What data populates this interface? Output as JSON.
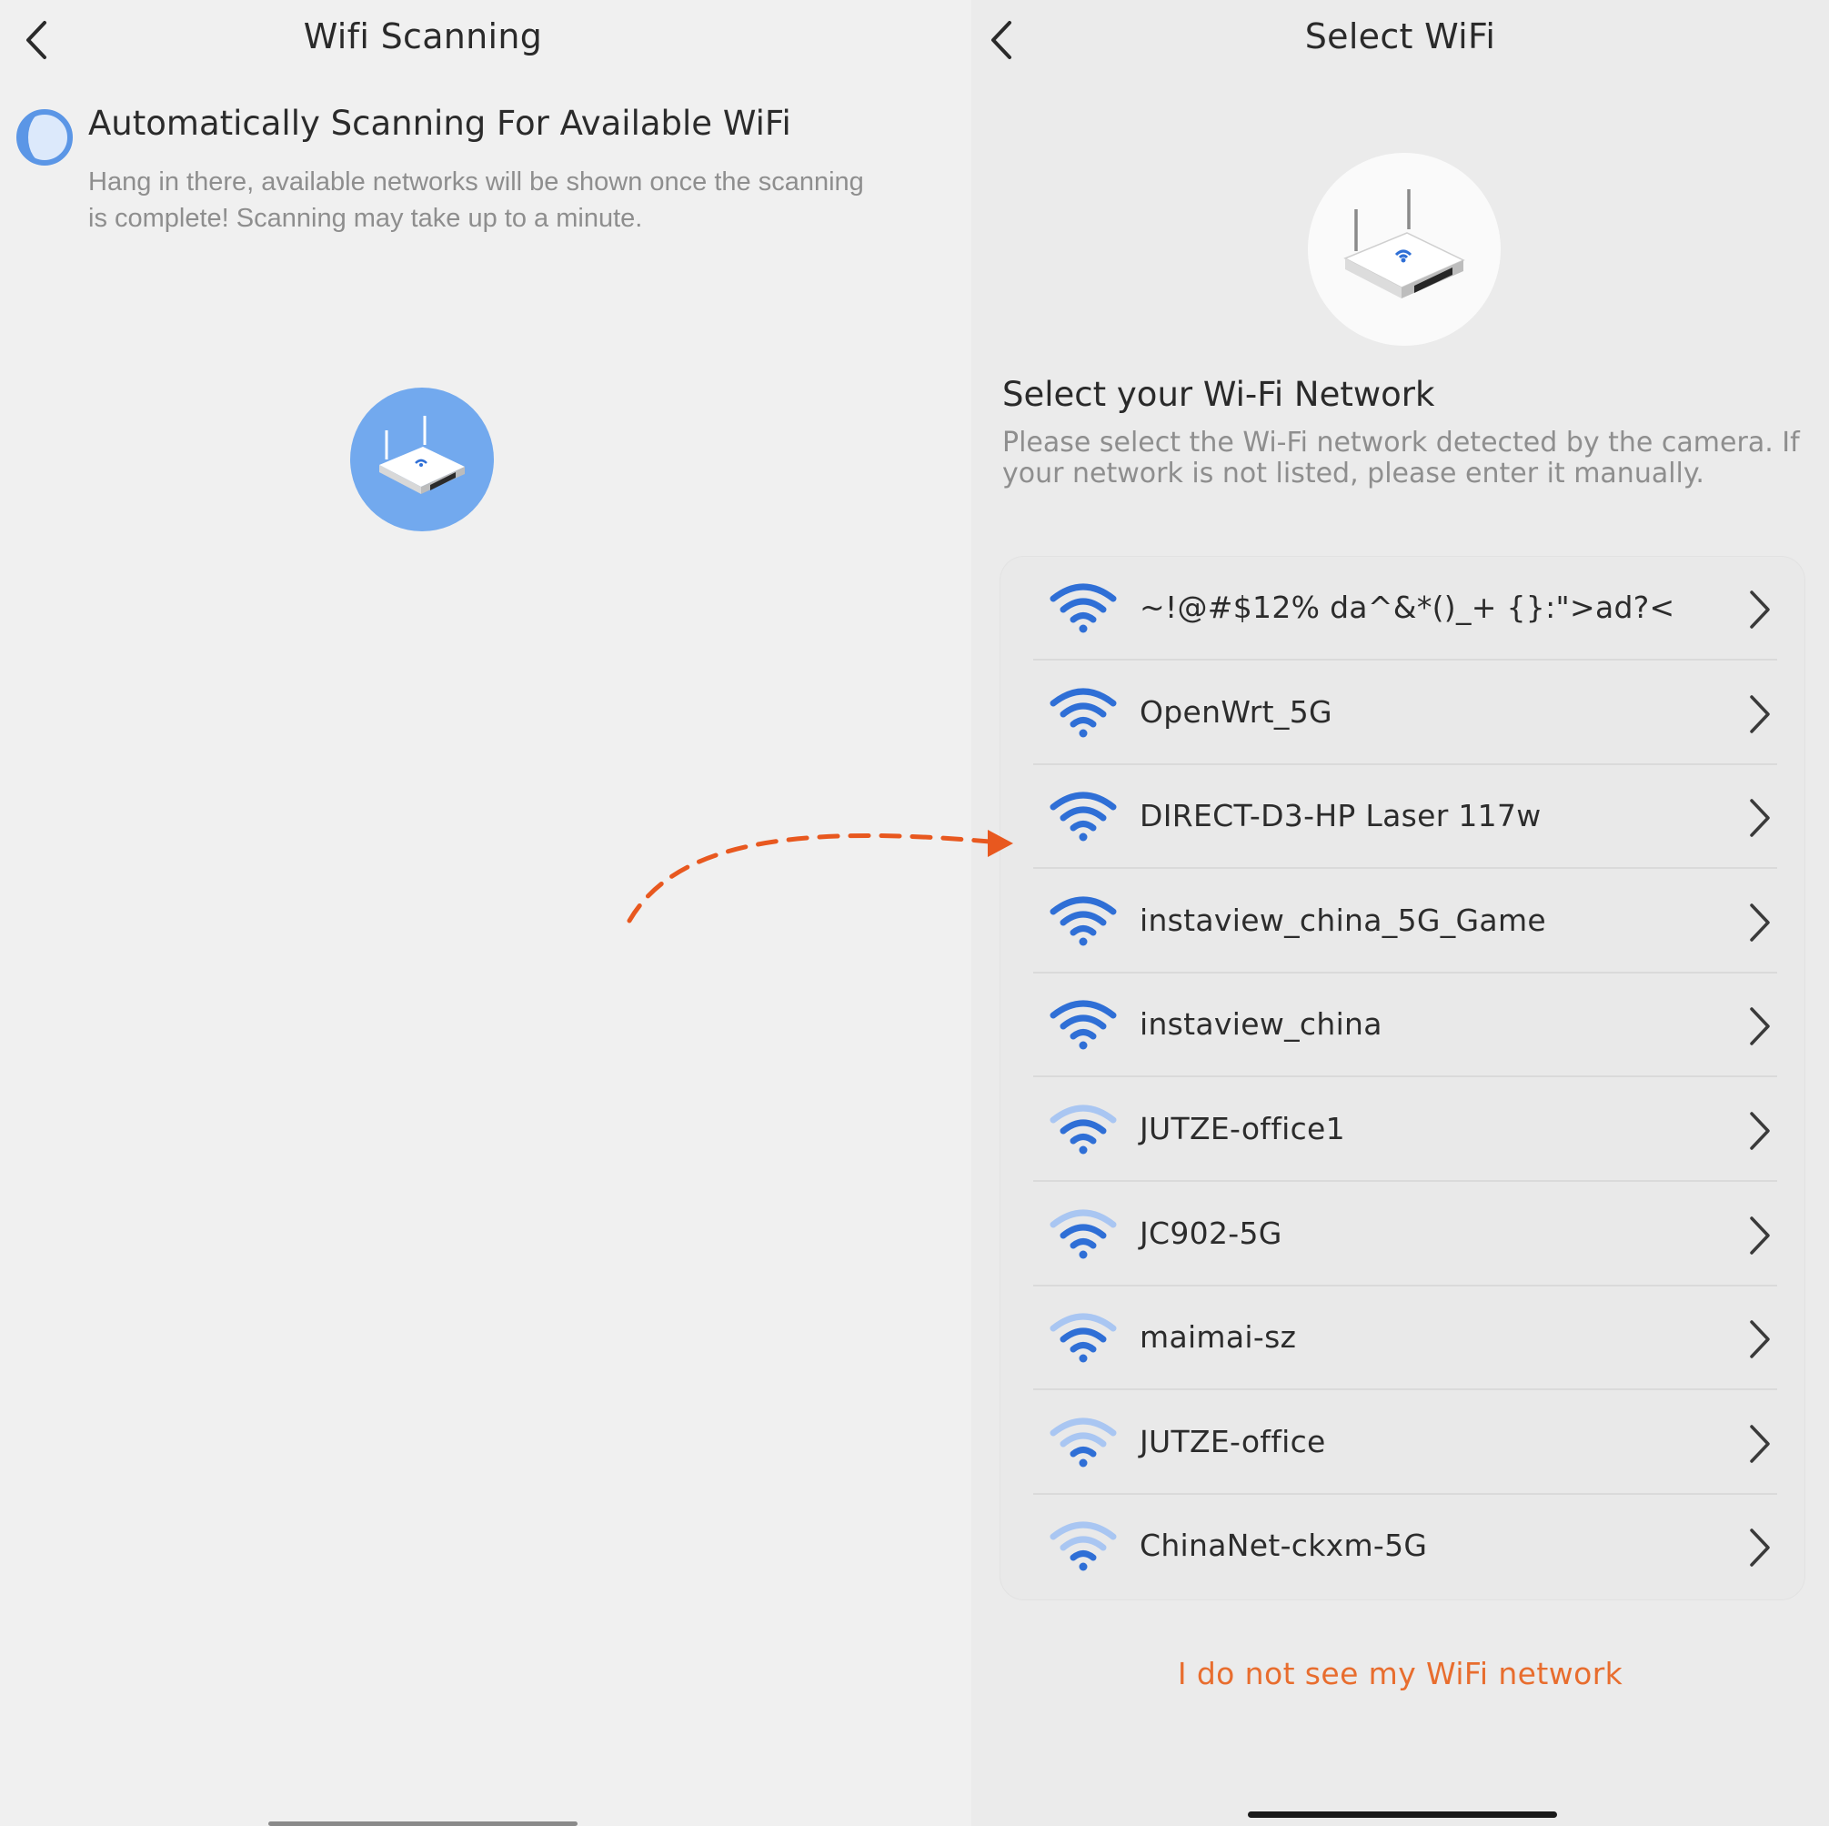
{
  "left_screen": {
    "title": "Wifi Scanning",
    "scan_heading": "Automatically Scanning For Available WiFi",
    "scan_message": "Hang in there, available networks will be shown once the scanning is complete! Scanning may take up to a minute.",
    "icons": {
      "back": "chevron-left-icon",
      "spinner": "loading-spinner-icon",
      "router": "router-icon"
    },
    "badge_color": "#72a9ee"
  },
  "right_screen": {
    "title": "Select WiFi",
    "section_title": "Select your Wi-Fi Network",
    "section_description": "Please select the Wi-Fi network detected by the camera. If your network is not listed, please enter it manually.",
    "networks": [
      {
        "ssid": "~!@#$12% da^&*()_+ {}:\">ad?<",
        "signal": 1.0
      },
      {
        "ssid": "OpenWrt_5G",
        "signal": 1.0
      },
      {
        "ssid": "DIRECT-D3-HP Laser 117w",
        "signal": 1.0
      },
      {
        "ssid": "instaview_china_5G_Game",
        "signal": 1.0
      },
      {
        "ssid": "instaview_china",
        "signal": 1.0
      },
      {
        "ssid": "JUTZE-office1",
        "signal": 0.75
      },
      {
        "ssid": "JC902-5G",
        "signal": 0.75
      },
      {
        "ssid": "maimai-sz",
        "signal": 0.75
      },
      {
        "ssid": "JUTZE-office",
        "signal": 0.5
      },
      {
        "ssid": "ChinaNet-ckxm-5G",
        "signal": 0.5
      }
    ],
    "manual_link": "I do not see my WiFi network",
    "colors": {
      "wifi_strong": "#2f6fd6",
      "wifi_weak": "#a9c6f2",
      "link": "#e86d2e"
    }
  },
  "annotation": {
    "arrow_color": "#e8581f"
  }
}
